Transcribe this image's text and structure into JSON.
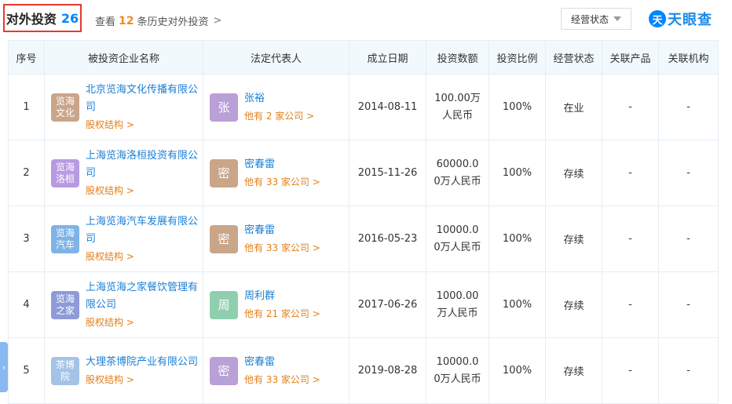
{
  "header": {
    "title": "对外投资",
    "count": "26",
    "history_prefix": "查看",
    "history_count": "12",
    "history_suffix": "条历史对外投资",
    "history_chevron": ">",
    "status_filter": "经营状态",
    "brand_logo": "天",
    "brand_text": "天眼查"
  },
  "columns": [
    "序号",
    "被投资企业名称",
    "法定代表人",
    "成立日期",
    "投资数额",
    "投资比例",
    "经营状态",
    "关联产品",
    "关联机构"
  ],
  "rows": [
    {
      "no": "1",
      "logo": "览海\n文化",
      "logo_color": "#c9a58a",
      "name": "北京览海文化传播有限公司",
      "equity": "股权结构 >",
      "rep_avatar": "张",
      "avatar_color": "#b9a0d6",
      "rep": "张裕",
      "rep_more": "他有 2 家公司 >",
      "date": "2014-08-11",
      "amount": "100.00万人民币",
      "ratio": "100%",
      "status": "在业",
      "product": "-",
      "org": "-"
    },
    {
      "no": "2",
      "logo": "览海\n洛桓",
      "logo_color": "#b79be0",
      "name": "上海览海洛桓投资有限公司",
      "equity": "股权结构 >",
      "rep_avatar": "密",
      "avatar_color": "#c9a58a",
      "rep": "密春雷",
      "rep_more": "他有 33 家公司 >",
      "date": "2015-11-26",
      "amount": "60000.00万人民币",
      "ratio": "100%",
      "status": "存续",
      "product": "-",
      "org": "-"
    },
    {
      "no": "3",
      "logo": "览海\n汽车",
      "logo_color": "#7fb3e6",
      "name": "上海览海汽车发展有限公司",
      "equity": "股权结构 >",
      "rep_avatar": "密",
      "avatar_color": "#c9a58a",
      "rep": "密春雷",
      "rep_more": "他有 33 家公司 >",
      "date": "2016-05-23",
      "amount": "10000.00万人民币",
      "ratio": "100%",
      "status": "存续",
      "product": "-",
      "org": "-"
    },
    {
      "no": "4",
      "logo": "览海\n之家",
      "logo_color": "#8d9bd8",
      "name": "上海览海之家餐饮管理有限公司",
      "equity": "股权结构 >",
      "rep_avatar": "周",
      "avatar_color": "#8fcfae",
      "rep": "周利群",
      "rep_more": "他有 21 家公司 >",
      "date": "2017-06-26",
      "amount": "1000.00万人民币",
      "ratio": "100%",
      "status": "存续",
      "product": "-",
      "org": "-"
    },
    {
      "no": "5",
      "logo": "茶博\n院",
      "logo_color": "#a4c3e6",
      "name": "大理茶博院产业有限公司",
      "equity": "股权结构 >",
      "rep_avatar": "密",
      "avatar_color": "#b9a0d6",
      "rep": "密春雷",
      "rep_more": "他有 33 家公司 >",
      "date": "2019-08-28",
      "amount": "10000.00万人民币",
      "ratio": "100%",
      "status": "存续",
      "product": "-",
      "org": "-"
    }
  ],
  "side_tab_icon": "chevron-right-icon"
}
